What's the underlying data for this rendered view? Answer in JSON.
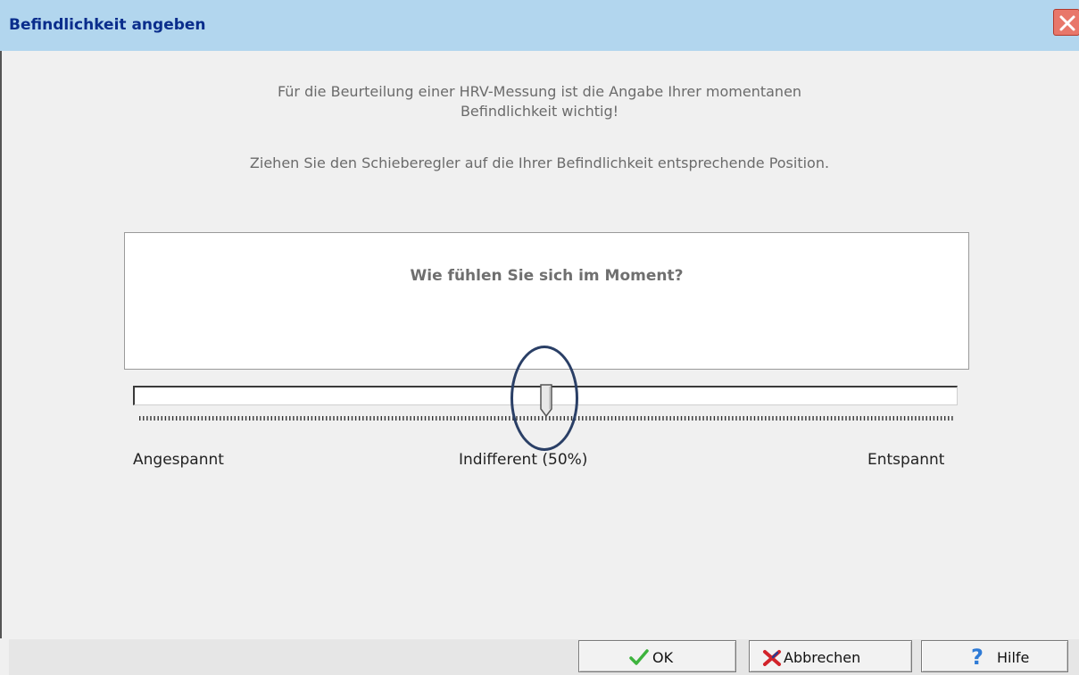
{
  "window": {
    "title": "Befindlichkeit angeben"
  },
  "instructions": {
    "line1": "Für die Beurteilung einer HRV-Messung ist die Angabe Ihrer momentanen",
    "line2": "Befindlichkeit wichtig!",
    "line3": "Ziehen Sie den Schieberegler auf die Ihrer Befindlichkeit entsprechende Position."
  },
  "question": "Wie fühlen Sie sich im Moment?",
  "slider": {
    "value_percent": 50,
    "label_left": "Angespannt",
    "label_center": "Indifferent (50%)",
    "label_right": "Entspannt"
  },
  "buttons": {
    "ok": "OK",
    "cancel": "Abbrechen",
    "help": "Hilfe"
  },
  "icons": {
    "close": "close-icon",
    "ok": "check-icon",
    "cancel": "cross-icon",
    "help": "question-mark-icon"
  },
  "colors": {
    "titlebar": "#b2d6ee",
    "title_text": "#0a2d8c",
    "check": "#3db33d",
    "cross": "#d2232a",
    "help": "#2f7bd6"
  }
}
